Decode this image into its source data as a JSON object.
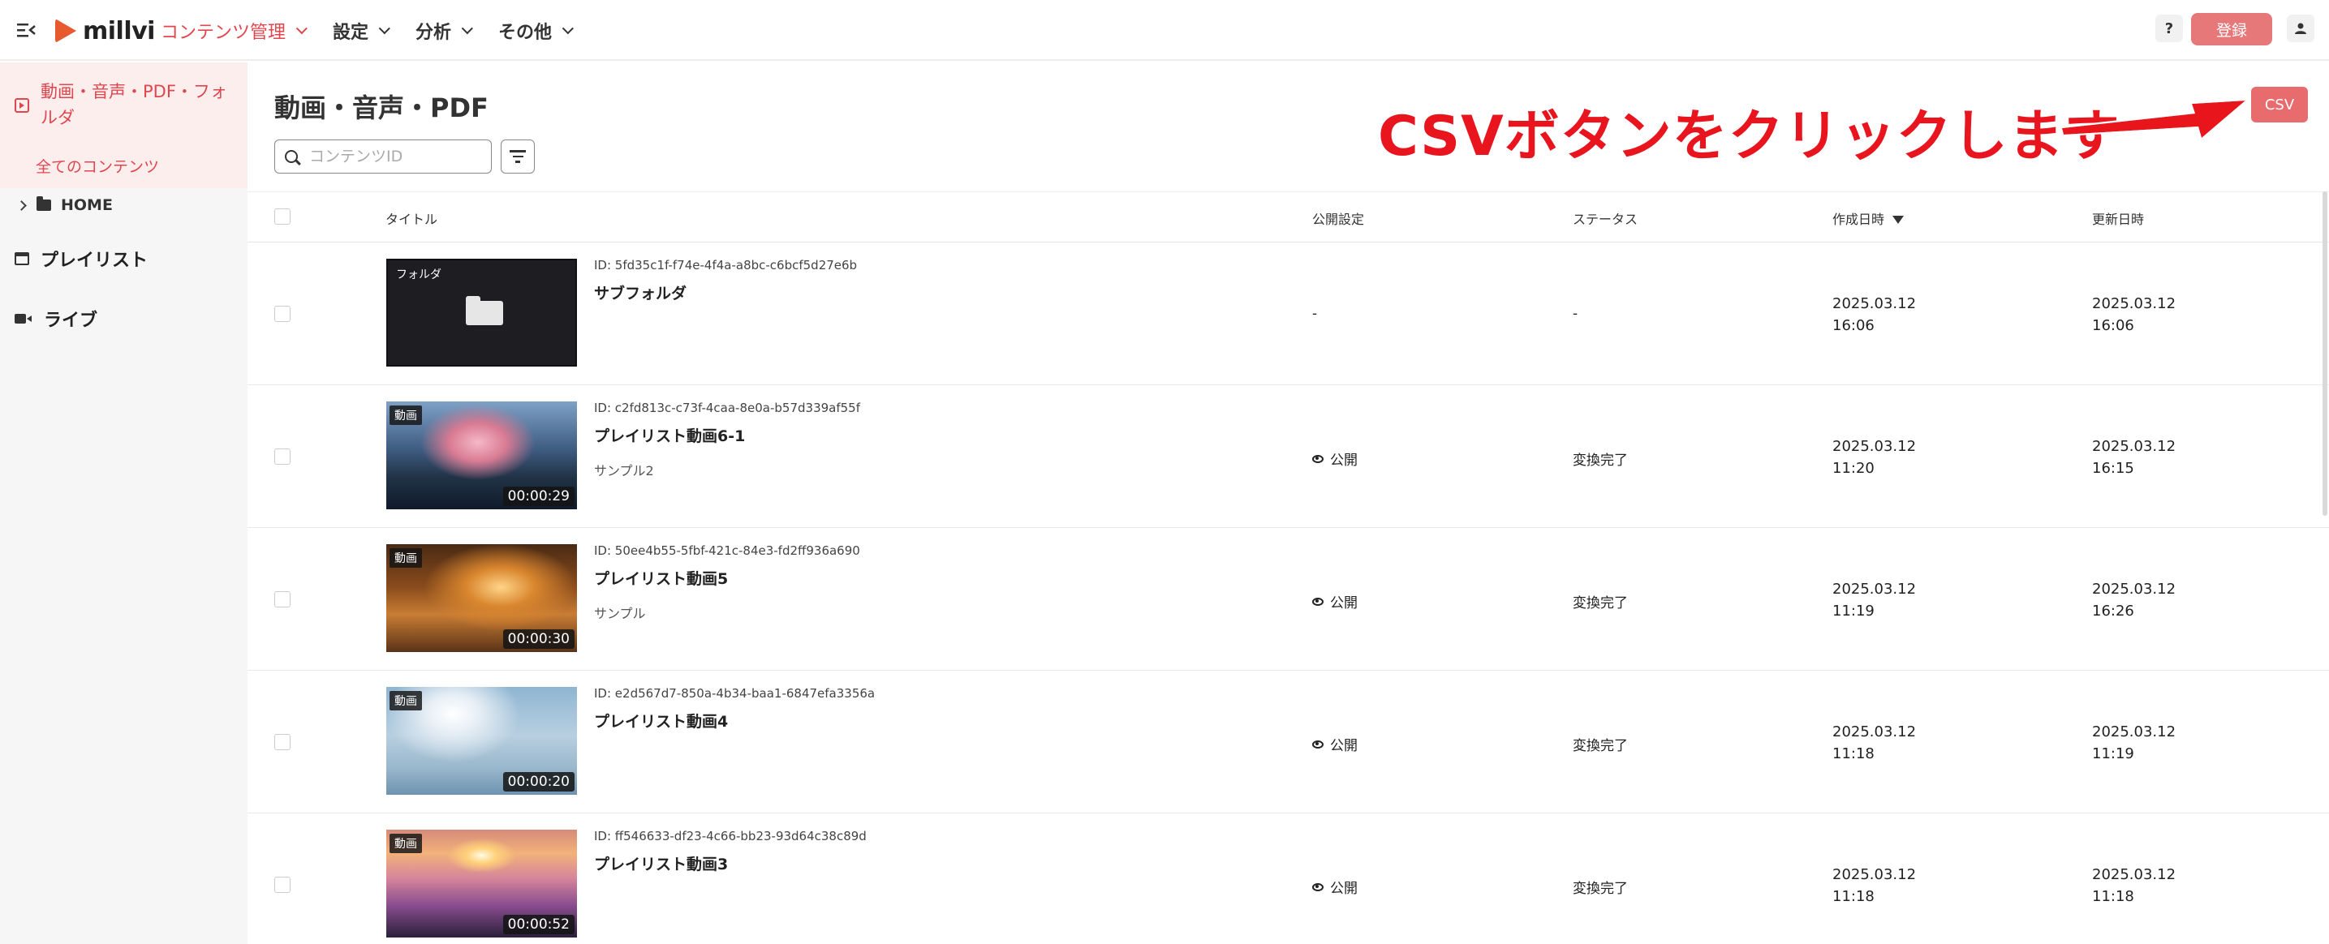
{
  "app": {
    "logo_text": "millvi",
    "nav": [
      {
        "label": "コンテンツ管理",
        "active": true
      },
      {
        "label": "設定",
        "active": false
      },
      {
        "label": "分析",
        "active": false
      },
      {
        "label": "その他",
        "active": false
      }
    ],
    "help_label": "?",
    "register_label": "登録",
    "accent_color": "#e0464e",
    "icons": {
      "menu": "menu-collapse-icon",
      "user": "user-icon",
      "help": "help-icon"
    }
  },
  "sidebar": {
    "section_title": "動画・音声・PDF・フォルダ",
    "section_sub": "全てのコンテンツ",
    "home_label": "HOME",
    "playlist_label": "プレイリスト",
    "live_label": "ライブ"
  },
  "main": {
    "title": "動画・音声・PDF",
    "search_placeholder": "コンテンツID",
    "csv_label": "CSV",
    "annotation": "CSVボタンをクリックします"
  },
  "table": {
    "headers": {
      "title": "タイトル",
      "public": "公開設定",
      "status": "ステータス",
      "created": "作成日時",
      "updated": "更新日時"
    },
    "rows": [
      {
        "type_tag": "フォルダ",
        "duration": "",
        "id": "ID: 5fd35c1f-f74e-4f4a-a8bc-c6bcf5d27e6b",
        "title": "サブフォルダ",
        "subtitle": "",
        "public": "-",
        "status": "-",
        "created_date": "2025.03.12",
        "created_time": "16:06",
        "updated_date": "2025.03.12",
        "updated_time": "16:06"
      },
      {
        "type_tag": "動画",
        "duration": "00:00:29",
        "id": "ID: c2fd813c-c73f-4caa-8e0a-b57d339af55f",
        "title": "プレイリスト動画6-1",
        "subtitle": "サンプル2",
        "public": "公開",
        "status": "変換完了",
        "created_date": "2025.03.12",
        "created_time": "11:20",
        "updated_date": "2025.03.12",
        "updated_time": "16:15"
      },
      {
        "type_tag": "動画",
        "duration": "00:00:30",
        "id": "ID: 50ee4b55-5fbf-421c-84e3-fd2ff936a690",
        "title": "プレイリスト動画5",
        "subtitle": "サンプル",
        "public": "公開",
        "status": "変換完了",
        "created_date": "2025.03.12",
        "created_time": "11:19",
        "updated_date": "2025.03.12",
        "updated_time": "16:26"
      },
      {
        "type_tag": "動画",
        "duration": "00:00:20",
        "id": "ID: e2d567d7-850a-4b34-baa1-6847efa3356a",
        "title": "プレイリスト動画4",
        "subtitle": "",
        "public": "公開",
        "status": "変換完了",
        "created_date": "2025.03.12",
        "created_time": "11:18",
        "updated_date": "2025.03.12",
        "updated_time": "11:19"
      },
      {
        "type_tag": "動画",
        "duration": "00:00:52",
        "id": "ID: ff546633-df23-4c66-bb23-93d64c38c89d",
        "title": "プレイリスト動画3",
        "subtitle": "",
        "public": "公開",
        "status": "変換完了",
        "created_date": "2025.03.12",
        "created_time": "11:18",
        "updated_date": "2025.03.12",
        "updated_time": "11:18"
      }
    ]
  }
}
